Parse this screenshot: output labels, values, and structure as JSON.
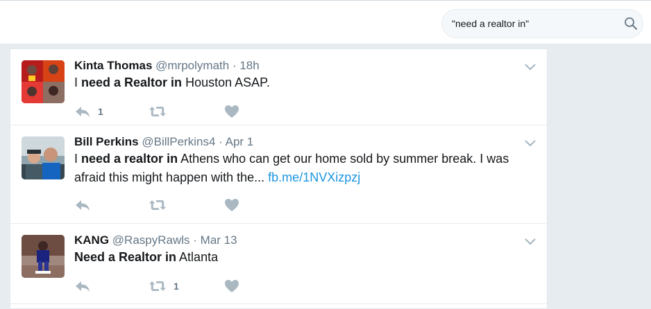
{
  "search": {
    "value": "\"need a realtor in\""
  },
  "colors": {
    "accent": "#1b95e0",
    "action_icon": "#aab8c2",
    "muted_text": "#657786"
  },
  "tweets": [
    {
      "fullname": "Kinta Thomas",
      "username": "@mrpolymath",
      "separator": "·",
      "time": "18h",
      "text_parts": [
        "I ",
        "need a Realtor in",
        " Houston ASAP."
      ],
      "link": "",
      "reply_count": "1",
      "retweet_count": "",
      "like_count": ""
    },
    {
      "fullname": "Bill Perkins",
      "username": "@BillPerkins4",
      "separator": "·",
      "time": "Apr 1",
      "text_parts": [
        "I ",
        "need a realtor in",
        " Athens who can get our home sold by summer break.  I was afraid this might happen with the... "
      ],
      "link": "fb.me/1NVXizpzj",
      "reply_count": "",
      "retweet_count": "",
      "like_count": ""
    },
    {
      "fullname": "KANG",
      "username": "@RaspyRawls",
      "separator": "·",
      "time": "Mar 13",
      "text_parts": [
        "",
        "Need a Realtor in",
        " Atlanta"
      ],
      "link": "",
      "reply_count": "",
      "retweet_count": "1",
      "like_count": ""
    }
  ]
}
